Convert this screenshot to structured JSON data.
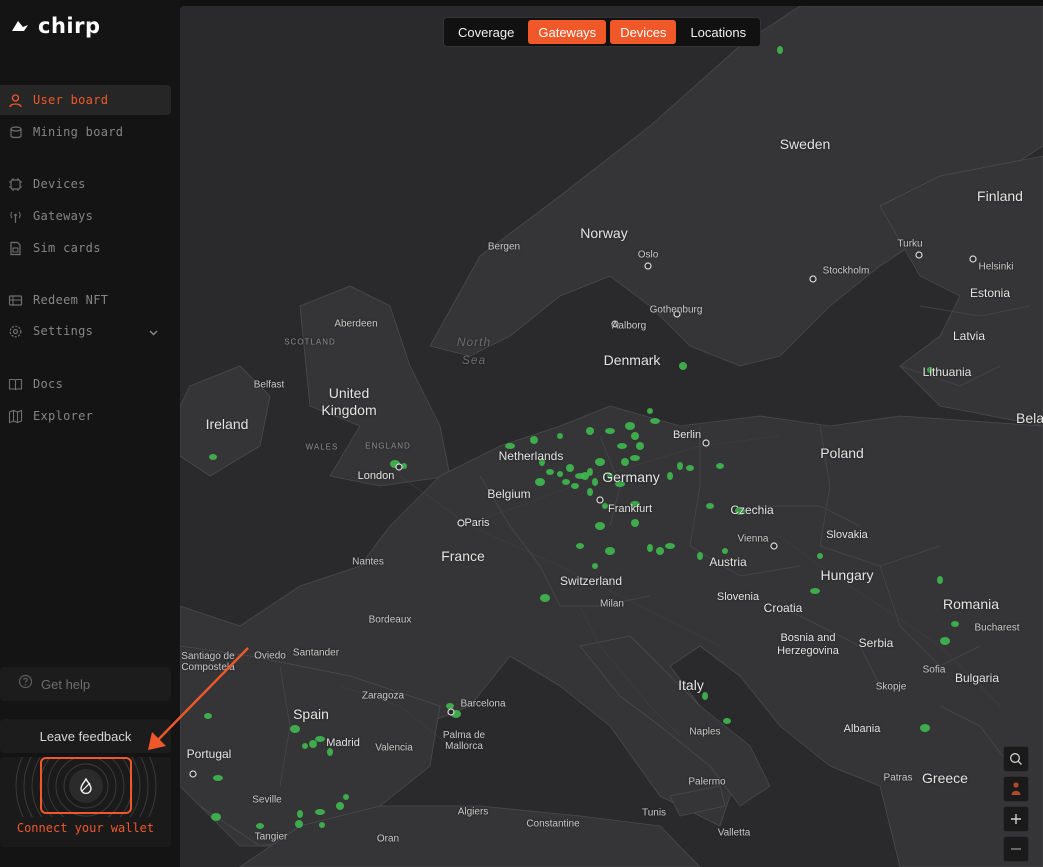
{
  "app": {
    "name": "chirp"
  },
  "sidebar": {
    "items": [
      {
        "label": "User board",
        "icon": "user-icon"
      },
      {
        "label": "Mining board",
        "icon": "coins-icon"
      },
      {
        "label": "Devices",
        "icon": "chip-icon"
      },
      {
        "label": "Gateways",
        "icon": "antenna-icon"
      },
      {
        "label": "Sim cards",
        "icon": "sim-card-icon"
      },
      {
        "label": "Redeem NFT",
        "icon": "ticket-icon"
      },
      {
        "label": "Settings",
        "icon": "gear-icon"
      },
      {
        "label": "Docs",
        "icon": "book-icon"
      },
      {
        "label": "Explorer",
        "icon": "map-icon"
      }
    ],
    "help_label": "Get help",
    "feedback_label": "Leave feedback",
    "wallet_label": "Connect your wallet"
  },
  "map": {
    "tabs": [
      {
        "label": "Coverage",
        "active": false
      },
      {
        "label": "Gateways",
        "active": true
      },
      {
        "label": "Devices",
        "active": true
      },
      {
        "label": "Locations",
        "active": false
      }
    ],
    "countries": [
      "Sweden",
      "Finland",
      "Norway",
      "Denmark",
      "Estonia",
      "Latvia",
      "Lithuania",
      "United Kingdom",
      "Ireland",
      "Netherlands",
      "Belgium",
      "Germany",
      "Poland",
      "Bela",
      "Czechia",
      "Slovakia",
      "Austria",
      "Hungary",
      "Switzerland",
      "France",
      "Romania",
      "Slovenia",
      "Croatia",
      "Bosnia and Herzegovina",
      "Serbia",
      "Bulgaria",
      "Italy",
      "Spain",
      "Portugal",
      "Albania",
      "Greece"
    ],
    "cities": [
      "Bergen",
      "Oslo",
      "Stockholm",
      "Turku",
      "Helsinki",
      "Gothenburg",
      "Aalborg",
      "Aberdeen",
      "Belfast",
      "London",
      "Berlin",
      "Paris",
      "Frankfurt",
      "Vienna",
      "Nantes",
      "Bordeaux",
      "Milan",
      "Santiago de Compostela",
      "Oviedo",
      "Santander",
      "Zaragoza",
      "Barcelona",
      "Madrid",
      "Valencia",
      "Palma de Mallorca",
      "Seville",
      "Tangier",
      "Oran",
      "Algiers",
      "Constantine",
      "Tunis",
      "Naples",
      "Palermo",
      "Valletta",
      "Patras",
      "Sofia",
      "Skopje",
      "Bucharest"
    ],
    "regions": [
      "SCOTLAND",
      "WALES",
      "ENGLAND"
    ],
    "seas": [
      "North",
      "Sea"
    ]
  },
  "colors": {
    "accent": "#f0582a",
    "device_dot": "#3fb84f",
    "map_bg": "#2a2a2c"
  },
  "map_controls": [
    "search-icon",
    "person-icon",
    "zoom-in-icon",
    "zoom-out-icon"
  ]
}
